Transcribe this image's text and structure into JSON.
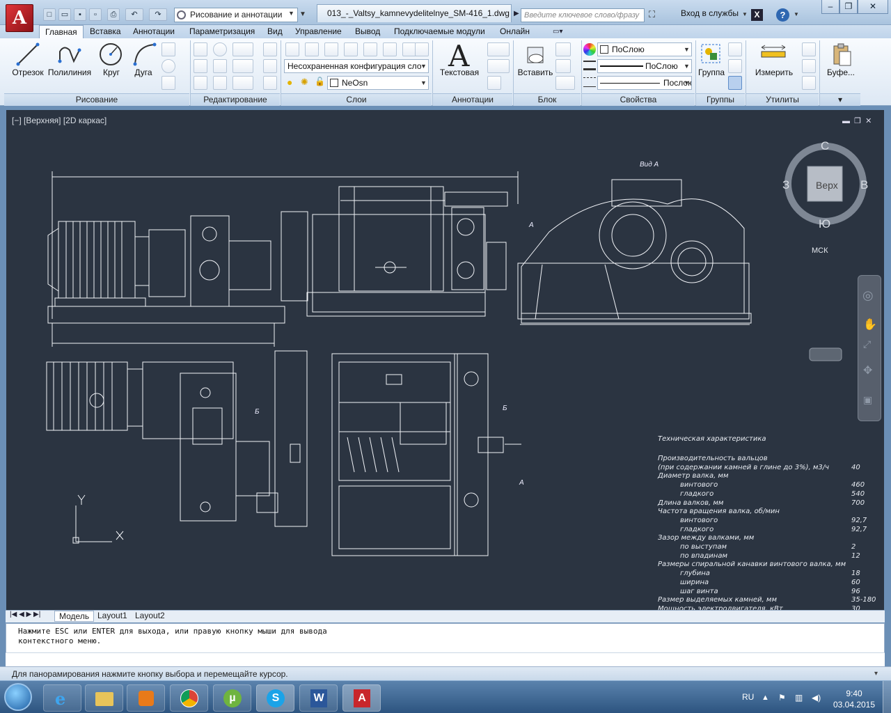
{
  "titlebar": {
    "workspace": "Рисование и аннотации",
    "document_tab": "013_-_Valtsy_kamnevydelitelnye_SM-416_1.dwg",
    "search_placeholder": "Введите ключевое слово/фразу",
    "signin": "Вход в службы",
    "help": "?"
  },
  "ribbon_tabs": [
    "Главная",
    "Вставка",
    "Аннотации",
    "Параметризация",
    "Вид",
    "Управление",
    "Вывод",
    "Подключаемые модули",
    "Онлайн"
  ],
  "panels": {
    "draw": {
      "title": "Рисование",
      "tools": [
        "Отрезок",
        "Полилиния",
        "Круг",
        "Дуга"
      ]
    },
    "modify": {
      "title": "Редактирование"
    },
    "layers": {
      "title": "Слои",
      "config": "Несохраненная конфигурация сло",
      "layer": "NeOsn"
    },
    "annotation": {
      "title": "Аннотации",
      "tool": "Текстовая"
    },
    "block": {
      "title": "Блок",
      "tool": "Вставить"
    },
    "properties": {
      "title": "Свойства",
      "color": "ПоСлою",
      "lineweight": "ПоСлою",
      "linetype": "Послою"
    },
    "groups": {
      "title": "Группы",
      "tool": "Группа"
    },
    "utilities": {
      "title": "Утилиты",
      "tool": "Измерить"
    },
    "clipboard": {
      "tool": "Буфе..."
    }
  },
  "viewport": {
    "label": "[−] [Верхняя] [2D каркас]",
    "viewcube": {
      "face": "Верх",
      "north": "С",
      "south": "Ю",
      "west": "З",
      "east": "В",
      "ucs": "МСК"
    }
  },
  "drawing": {
    "view_label": "Вид А",
    "section_a": "А",
    "section_b": "Б",
    "tech_title": "Техническая характеристика",
    "tech_rows": [
      {
        "label": "Производительность вальцов",
        "value": ""
      },
      {
        "label": "(при содержании камней в глине до 3%), м3/ч",
        "value": "40"
      },
      {
        "label": "Диаметр валка, мм",
        "value": ""
      },
      {
        "label": "винтового",
        "value": "460",
        "indent": true
      },
      {
        "label": "гладкого",
        "value": "540",
        "indent": true
      },
      {
        "label": "Длина валков, мм",
        "value": "700"
      },
      {
        "label": "Частота вращения валка, об/мин",
        "value": ""
      },
      {
        "label": "винтового",
        "value": "92,7",
        "indent": true
      },
      {
        "label": "гладкого",
        "value": "92,7",
        "indent": true
      },
      {
        "label": "Зазор между валками, мм",
        "value": ""
      },
      {
        "label": "по выступам",
        "value": "2",
        "indent": true
      },
      {
        "label": "по впадинам",
        "value": "12",
        "indent": true
      },
      {
        "label": "Размеры спиральной канавки винтового валка, мм",
        "value": ""
      },
      {
        "label": "глубина",
        "value": "18",
        "indent": true
      },
      {
        "label": "ширина",
        "value": "60",
        "indent": true
      },
      {
        "label": "шаг винта",
        "value": "96",
        "indent": true
      },
      {
        "label": "Размер выделяемых камней, мм",
        "value": "35-180"
      },
      {
        "label": "Мощность электродвигателя, кВт",
        "value": "30"
      }
    ]
  },
  "layout_tabs": [
    "Модель",
    "Layout1",
    "Layout2"
  ],
  "command_line": [
    "Нажмите ESC или ENTER для выхода, или правую кнопку мыши для вывода",
    "контекстного меню."
  ],
  "status_text": "Для панорамирования нажмите кнопку выбора и перемещайте курсор.",
  "taskbar": {
    "lang": "RU",
    "time": "9:40",
    "date": "03.04.2015"
  }
}
